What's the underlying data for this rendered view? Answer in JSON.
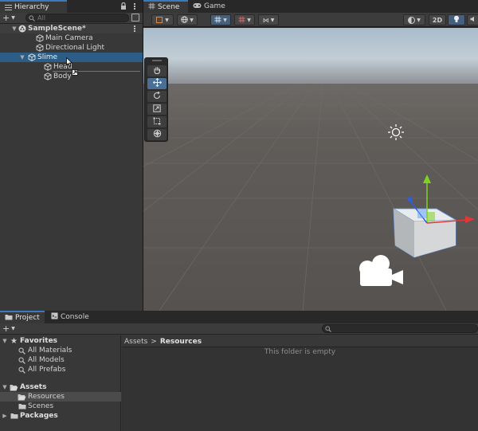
{
  "hierarchy": {
    "tab_label": "Hierarchy",
    "add_label": "+",
    "search_placeholder": "All",
    "scene_name": "SampleScene*",
    "items": [
      {
        "label": "Main Camera"
      },
      {
        "label": "Directional Light"
      },
      {
        "label": "Slime"
      },
      {
        "label": "Head"
      },
      {
        "label": "Body"
      }
    ]
  },
  "scene_view": {
    "tabs": [
      {
        "label": "Scene"
      },
      {
        "label": "Game"
      }
    ],
    "toggle_2d_label": "2D",
    "accent_color": "#3a79bb"
  },
  "project": {
    "tabs": [
      {
        "label": "Project"
      },
      {
        "label": "Console"
      }
    ],
    "add_label": "+",
    "favorites": {
      "label": "Favorites",
      "items": [
        "All Materials",
        "All Models",
        "All Prefabs"
      ]
    },
    "assets": {
      "label": "Assets",
      "items": [
        "Resources",
        "Scenes"
      ]
    },
    "packages_label": "Packages",
    "breadcrumb": [
      "Assets",
      ">",
      "Resources"
    ],
    "empty_message": "This folder is empty"
  }
}
